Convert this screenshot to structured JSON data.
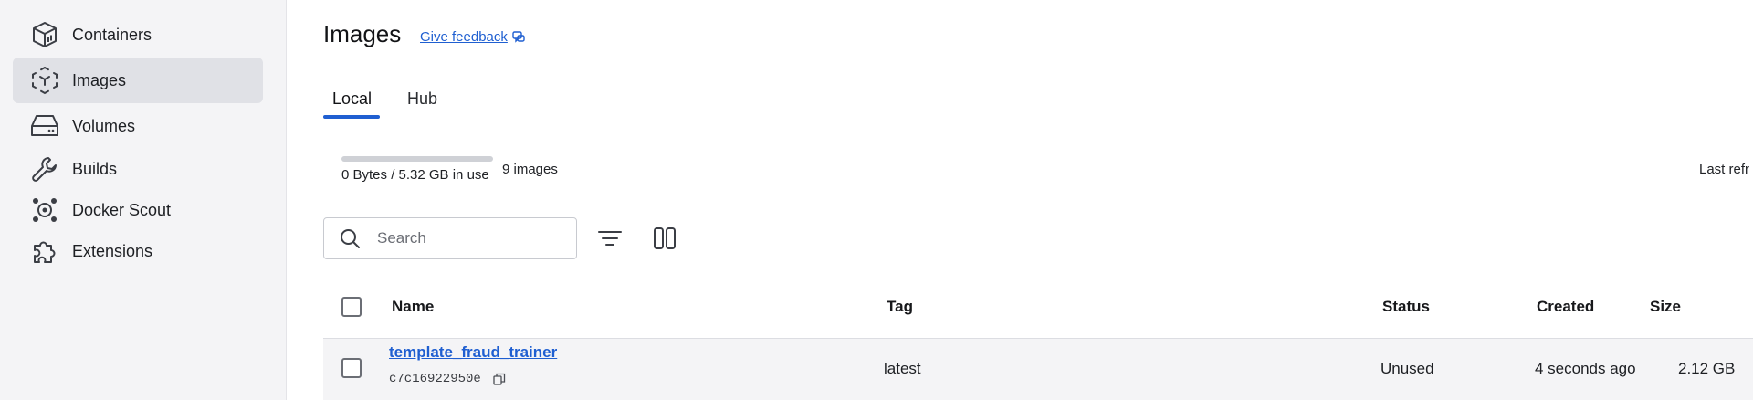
{
  "sidebar": {
    "items": [
      {
        "label": "Containers",
        "icon": "container-box-icon"
      },
      {
        "label": "Images",
        "icon": "image-cube-icon",
        "active": true
      },
      {
        "label": "Volumes",
        "icon": "disk-drive-icon"
      },
      {
        "label": "Builds",
        "icon": "wrench-icon"
      },
      {
        "label": "Docker Scout",
        "icon": "scout-target-icon"
      },
      {
        "label": "Extensions",
        "icon": "puzzle-piece-icon"
      }
    ]
  },
  "header": {
    "title": "Images",
    "feedback_link": "Give feedback"
  },
  "tabs": [
    {
      "label": "Local",
      "active": true
    },
    {
      "label": "Hub",
      "active": false
    }
  ],
  "usage": {
    "text": "0 Bytes / 5.32 GB in use",
    "fill_fraction": 0.0,
    "count": "9 images",
    "last_refresh": "Last refr"
  },
  "search": {
    "placeholder": "Search",
    "value": ""
  },
  "table": {
    "columns": [
      "Name",
      "Tag",
      "Status",
      "Created",
      "Size"
    ],
    "rows": [
      {
        "name": "template_fraud_trainer",
        "id": "c7c16922950e",
        "tag": "latest",
        "status": "Unused",
        "created": "4 seconds ago",
        "size": "2.12 GB"
      }
    ]
  },
  "colors": {
    "accent": "#1f5fd1",
    "sidebar_bg": "#f4f4f6",
    "active_item_bg": "#e0e1e6"
  }
}
